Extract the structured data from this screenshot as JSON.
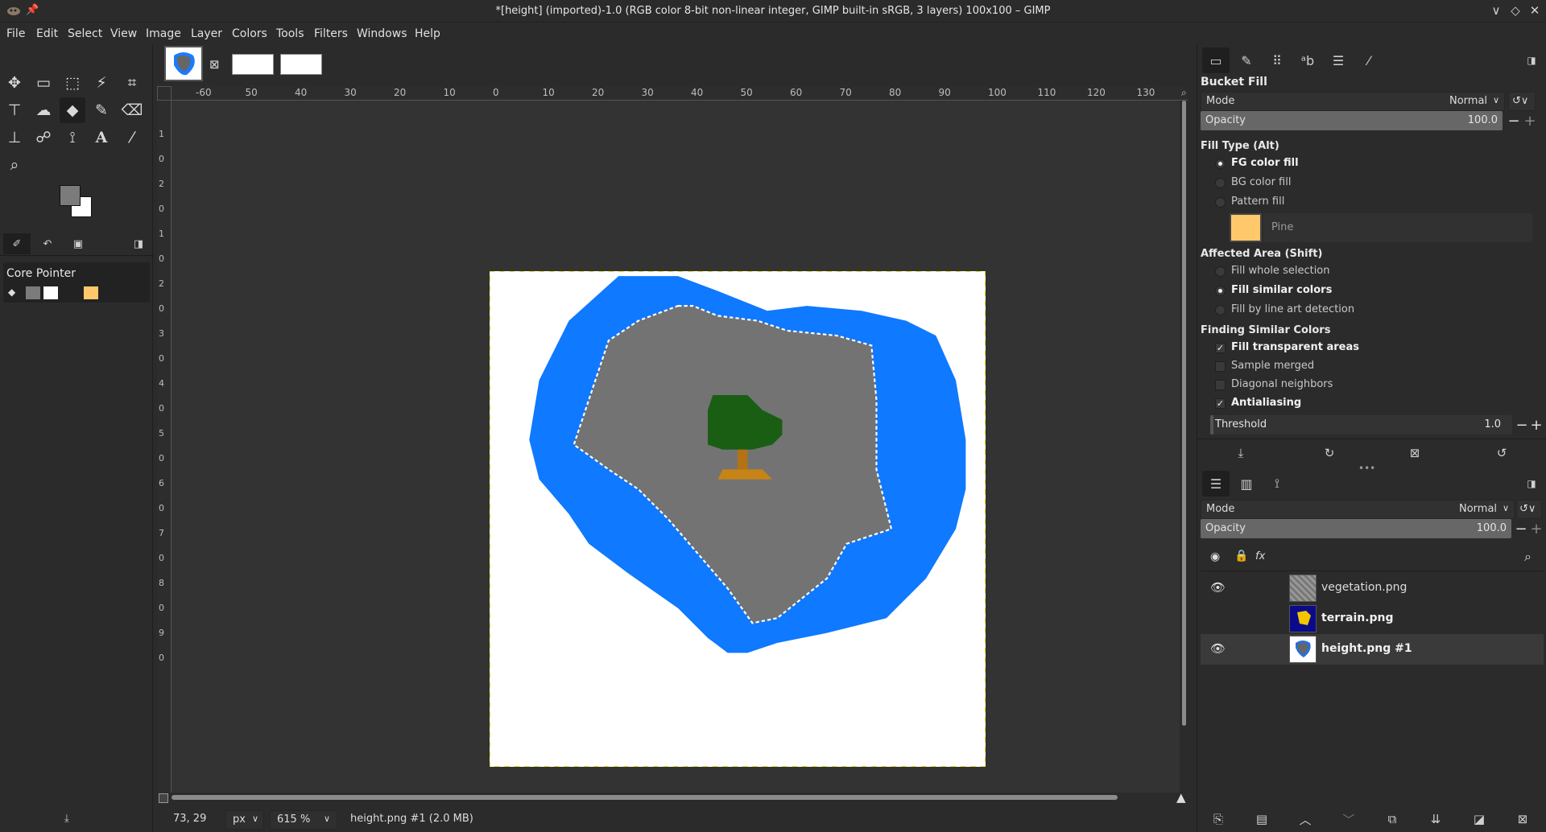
{
  "window": {
    "title": "*[height] (imported)-1.0 (RGB color 8-bit non-linear integer, GIMP built-in sRGB, 3 layers) 100x100 – GIMP",
    "controls": [
      "∨",
      "◇",
      "✕"
    ]
  },
  "menu": [
    "File",
    "Edit",
    "Select",
    "View",
    "Image",
    "Layer",
    "Colors",
    "Tools",
    "Filters",
    "Windows",
    "Help"
  ],
  "toolbox": {
    "device_status_title": "Core Pointer",
    "fg_color": "#7b7b7b",
    "bg_color": "#ffffff",
    "pattern_color": "#ffc86a"
  },
  "rulers": {
    "h_labels": [
      "-60",
      "50",
      "40",
      "30",
      "20",
      "10",
      "0",
      "10",
      "20",
      "30",
      "40",
      "50",
      "60",
      "70",
      "80",
      "90",
      "100",
      "110",
      "120",
      "130"
    ],
    "v_labels": [
      "1",
      "0",
      "2",
      "0",
      "1",
      "0",
      "2",
      "0",
      "3",
      "0",
      "4",
      "0",
      "5",
      "0",
      "6",
      "0",
      "7",
      "0",
      "8",
      "0",
      "9",
      "0"
    ]
  },
  "status": {
    "coords": "73, 29",
    "unit": "px",
    "zoom": "615 %",
    "info": "height.png #1 (2.0 MB)"
  },
  "tool_options": {
    "title": "Bucket Fill",
    "mode_label": "Mode",
    "mode_value": "Normal",
    "opacity_label": "Opacity",
    "opacity_value": "100.0",
    "fill_type_title": "Fill Type  (Alt)",
    "fill_types": [
      "FG color fill",
      "BG color fill",
      "Pattern fill"
    ],
    "fill_type_selected": "FG color fill",
    "pattern_name": "Pine",
    "affected_title": "Affected Area  (Shift)",
    "affected": [
      "Fill whole selection",
      "Fill similar colors",
      "Fill by line art detection"
    ],
    "affected_selected": "Fill similar colors",
    "similar_title": "Finding Similar Colors",
    "checks": [
      {
        "label": "Fill transparent areas",
        "checked": true
      },
      {
        "label": "Sample merged",
        "checked": false
      },
      {
        "label": "Diagonal neighbors",
        "checked": false
      },
      {
        "label": "Antialiasing",
        "checked": true
      }
    ],
    "threshold_label": "Threshold",
    "threshold_value": "1.0"
  },
  "layers_panel": {
    "mode_label": "Mode",
    "mode_value": "Normal",
    "opacity_label": "Opacity",
    "opacity_value": "100.0",
    "layers": [
      {
        "name": "vegetation.png",
        "visible": true,
        "bold": false,
        "selected": false
      },
      {
        "name": "terrain.png",
        "visible": false,
        "bold": true,
        "selected": false
      },
      {
        "name": "height.png #1",
        "visible": true,
        "bold": true,
        "selected": true
      }
    ]
  }
}
